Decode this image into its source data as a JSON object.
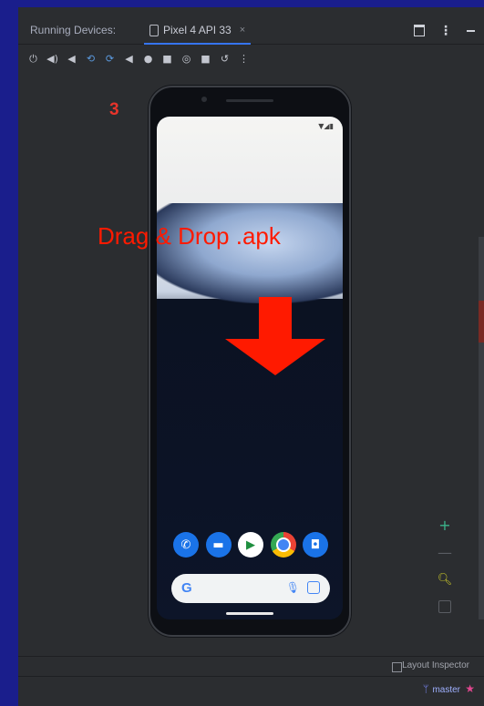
{
  "tabbar": {
    "title": "Running Devices:",
    "device_tab": "Pixel 4 API 33",
    "close": "×"
  },
  "toolbar": {
    "icons": [
      "power-icon",
      "volume-up-icon",
      "volume-down-icon",
      "rotate-left-icon",
      "rotate-right-icon",
      "back-icon",
      "home-icon",
      "overview-icon",
      "screenshot-icon",
      "screen-record-icon",
      "reset-icon",
      "more-icon"
    ]
  },
  "annotation": {
    "step": "3",
    "instruction": "Drag & Drop .apk"
  },
  "device": {
    "google_logo": "G",
    "dock_apps": [
      "phone",
      "messages",
      "play-store",
      "chrome",
      "camera"
    ]
  },
  "bottom": {
    "layout_inspector": "Layout Inspector",
    "branch": "master"
  },
  "colors": {
    "outer_border": "#1a1e8c",
    "ide_background": "#2b2d30",
    "annotation": "#ff1a00"
  }
}
